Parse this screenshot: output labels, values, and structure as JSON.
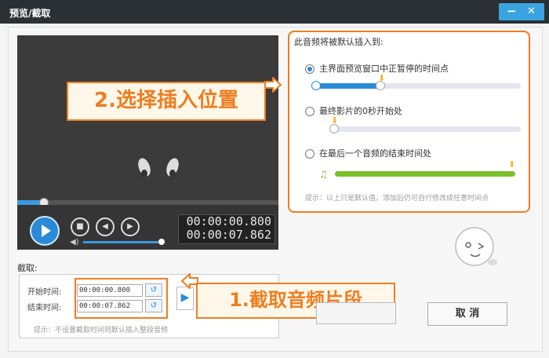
{
  "window": {
    "title": "预览/截取",
    "minimize": "−",
    "close": "✕",
    "accent": "#3aa4e0"
  },
  "player": {
    "current_time": "00:00:00.800",
    "total_time": "00:00:07.862",
    "progress_fraction": 0.1,
    "volume_fraction": 0.95
  },
  "callouts": {
    "step2": "2.选择插入位置",
    "step1": "1.截取音频片段"
  },
  "insert": {
    "title": "此音频将被默认插入到:",
    "options": [
      {
        "label": "主界面预览窗口中正暂停的时间点",
        "selected": true
      },
      {
        "label": "最终影片的0秒开始处",
        "selected": false
      },
      {
        "label": "在最后一个音频的结束时间处",
        "selected": false
      }
    ],
    "hint": "提示：以上只是默认值，添加后仍可自行修改成任意时间点"
  },
  "clip": {
    "section_label": "截取:",
    "start_label": "开始时间:",
    "start_value": "00:00:00.800",
    "end_label": "结束时间:",
    "end_value": "00:00:07.862",
    "hint": "提示：不设置截取时间则默认插入整段音频"
  },
  "buttons": {
    "cancel": "取 消"
  },
  "colors": {
    "highlight": "#ef7d1f",
    "blue": "#2b8ad8",
    "green": "#7cbf2a"
  }
}
